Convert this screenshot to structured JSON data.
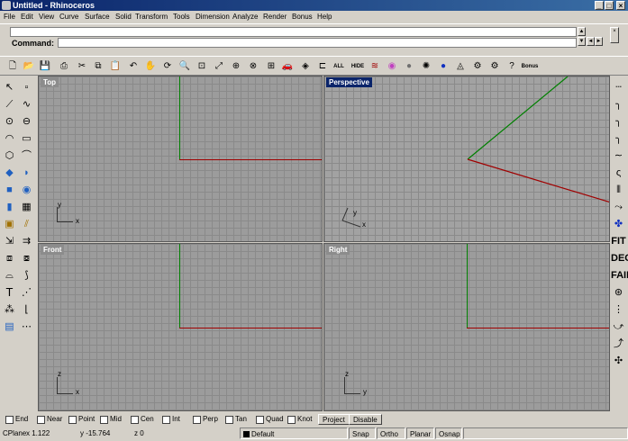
{
  "window": {
    "title": "Untitled - Rhinoceros",
    "minimize": "_",
    "maximize": "□",
    "close": "×"
  },
  "menu": [
    "File",
    "Edit",
    "View",
    "Curve",
    "Surface",
    "Solid",
    "Transform",
    "Tools",
    "Dimension",
    "Analyze",
    "Render",
    "Bonus",
    "Help"
  ],
  "command": {
    "label": "Command:",
    "history": "",
    "value": ""
  },
  "toolbar": {
    "all_label": "ALL",
    "hide_label": "HIDE",
    "bonus_label": "Bonus"
  },
  "viewports": {
    "top": {
      "label": "Top",
      "axis_y": "y",
      "axis_x": "x"
    },
    "perspective": {
      "label": "Perspective",
      "axis_y": "y",
      "axis_x": "x"
    },
    "front": {
      "label": "Front",
      "axis_y": "z",
      "axis_x": "x"
    },
    "right": {
      "label": "Right",
      "axis_y": "z",
      "axis_x": "y"
    }
  },
  "right_toolbar": {
    "fit": "FIT",
    "deg": "DEG",
    "fair": "FAIR"
  },
  "osnap": {
    "items": [
      "End",
      "Near",
      "Point",
      "Mid",
      "Cen",
      "Int",
      "Perp",
      "Tan",
      "Quad",
      "Knot"
    ],
    "project": "Project",
    "disable": "Disable"
  },
  "status": {
    "cplane": "CPlane",
    "x": "x 1.122",
    "y": "y -15.764",
    "z": "z 0",
    "layer": "Default",
    "layer_color": "#000000",
    "snap": "Snap",
    "ortho": "Ortho",
    "planar": "Planar",
    "osnap": "Osnap"
  },
  "colors": {
    "x_axis": "#a00000",
    "y_axis": "#008000",
    "active_viewport": "#0a246a",
    "titlebar": "#0a246a"
  }
}
